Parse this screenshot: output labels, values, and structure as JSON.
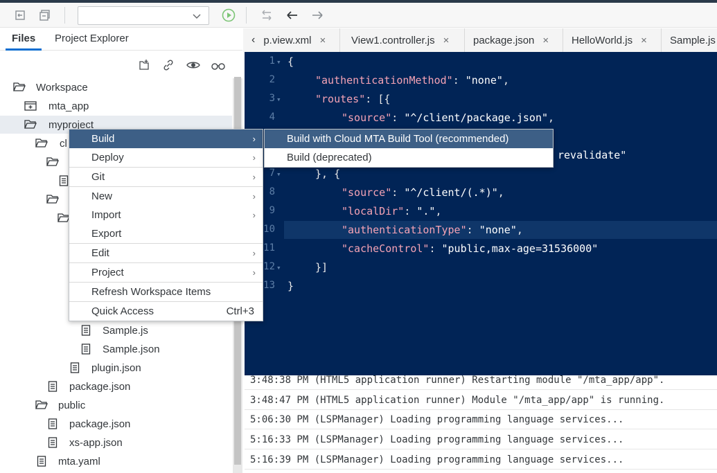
{
  "toolbar": {
    "select_value": "",
    "icons": [
      "undo-icon",
      "redo-icon",
      "dropdown-chevron-icon",
      "run-icon",
      "swap-icon",
      "back-icon",
      "forward-icon"
    ]
  },
  "left_panel": {
    "tabs": [
      {
        "label": "Files",
        "active": true
      },
      {
        "label": "Project Explorer",
        "active": false
      }
    ],
    "tree": [
      {
        "label": "Workspace",
        "icon": "folder-open-icon"
      },
      {
        "label": "mta_app",
        "icon": "package-icon"
      },
      {
        "label": "myproject",
        "icon": "folder-open-icon"
      },
      {
        "label": "cl",
        "icon": "folder-open-icon"
      },
      {
        "label": "",
        "icon": "folder-open-icon"
      },
      {
        "label": "",
        "icon": "file-icon"
      },
      {
        "label": "",
        "icon": "folder-open-icon"
      },
      {
        "label": "",
        "icon": "folder-open-icon"
      },
      {
        "label": "Sample.js",
        "icon": "file-icon"
      },
      {
        "label": "Sample.json",
        "icon": "file-icon"
      },
      {
        "label": "plugin.json",
        "icon": "file-icon"
      },
      {
        "label": "package.json",
        "icon": "file-icon"
      },
      {
        "label": "public",
        "icon": "folder-open-icon"
      },
      {
        "label": "package.json",
        "icon": "file-icon"
      },
      {
        "label": "xs-app.json",
        "icon": "file-icon"
      },
      {
        "label": "mta.yaml",
        "icon": "file-icon"
      }
    ]
  },
  "editor": {
    "tabs": [
      {
        "label": "p.view.xml"
      },
      {
        "label": "View1.controller.js"
      },
      {
        "label": "package.json"
      },
      {
        "label": "HelloWorld.js"
      },
      {
        "label": "Sample.js"
      }
    ],
    "lines": [
      {
        "n": "1",
        "fold": true
      },
      {
        "n": "2",
        "fold": false
      },
      {
        "n": "3",
        "fold": true
      },
      {
        "n": "4",
        "fold": false
      },
      {
        "n": "5",
        "fold": false
      },
      {
        "n": "6",
        "fold": false
      },
      {
        "n": "7",
        "fold": true
      },
      {
        "n": "8",
        "fold": false
      },
      {
        "n": "9",
        "fold": false
      },
      {
        "n": "10",
        "fold": false
      },
      {
        "n": "11",
        "fold": false
      },
      {
        "n": "12",
        "fold": true
      },
      {
        "n": "13",
        "fold": false
      }
    ],
    "code": {
      "l1": "{",
      "l2_key": "\"authenticationMethod\"",
      "l2_val": "\"none\"",
      "l3_key": "\"routes\"",
      "l3_rest": "[{",
      "l4_key": "\"source\"",
      "l4_val": "\"^/client/package.json\"",
      "l6_val": "revalidate\"",
      "l7": "}, {",
      "l8_key": "\"source\"",
      "l8_val": "\"^/client/(.*)\"",
      "l9_key": "\"localDir\"",
      "l9_val": "\".\"",
      "l10_key": "\"authenticationType\"",
      "l10_val": "\"none\"",
      "l11_key": "\"cacheControl\"",
      "l11_val": "\"public,max-age=31536000\"",
      "l12": "}]",
      "l13": "}"
    }
  },
  "console": {
    "rows": [
      "3:48:38 PM (HTML5 application runner) Restarting module \"/mta_app/app\".",
      "3:48:47 PM (HTML5 application runner) Module \"/mta_app/app\" is running.",
      "5:06:30 PM (LSPManager) Loading programming language services...",
      "5:16:33 PM (LSPManager) Loading programming language services...",
      "5:16:39 PM (LSPManager) Loading programming language services..."
    ]
  },
  "context_menu": {
    "items": [
      {
        "label": "Build",
        "arrow": "›",
        "highlighted": true
      },
      {
        "label": "Deploy",
        "arrow": "›"
      },
      {
        "label": "Git",
        "arrow": "›"
      },
      {
        "label": "New",
        "arrow": "›"
      },
      {
        "label": "Import",
        "arrow": "›"
      },
      {
        "label": "Export",
        "arrow": ""
      },
      {
        "label": "Edit",
        "arrow": "›"
      },
      {
        "label": "Project",
        "arrow": "›"
      },
      {
        "label": "Refresh Workspace Items",
        "arrow": ""
      },
      {
        "label": "Quick Access",
        "shortcut": "Ctrl+3"
      }
    ],
    "submenu": [
      {
        "label": "Build with Cloud MTA Build Tool (recommended)",
        "highlighted": true
      },
      {
        "label": "Build (deprecated)"
      }
    ]
  }
}
